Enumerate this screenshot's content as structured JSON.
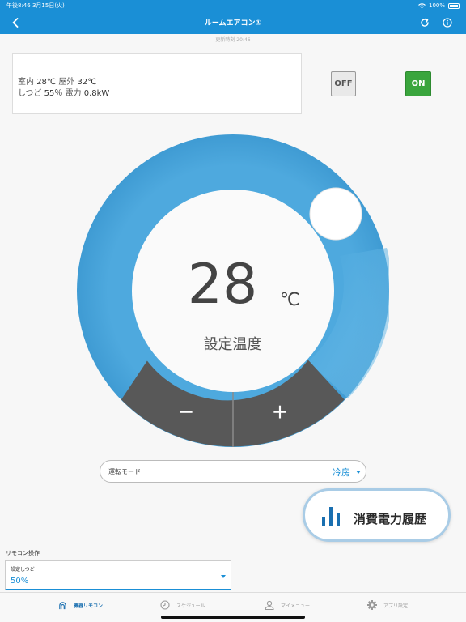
{
  "status_bar": {
    "time": "午後8:46",
    "date": "3月15日(火)",
    "battery": "100%"
  },
  "header": {
    "title": "ルームエアコン①"
  },
  "update_time": "---- 更新時刻 20:46 ----",
  "sensor_info": {
    "indoor_label": "室内",
    "indoor_value": "28℃",
    "outdoor_label": "屋外",
    "outdoor_value": "32℃",
    "humidity_label": "しつど",
    "humidity_value": "55％",
    "power_label": "電力",
    "power_value": "0.8kW"
  },
  "power_buttons": {
    "off_label": "OFF",
    "on_label": "ON"
  },
  "thermostat": {
    "set_temperature": "28",
    "unit": "℃",
    "label": "設定温度",
    "minus_label": "－",
    "plus_label": "＋"
  },
  "mode_select": {
    "label": "運転モード",
    "value": "冷房"
  },
  "power_history": {
    "label": "消費電力履歴"
  },
  "remote_section": {
    "header": "リモコン操作",
    "humidity_field": {
      "label": "設定しつど",
      "value": "50%"
    }
  },
  "tab_bar": {
    "items": [
      {
        "label": "機器リモコン",
        "icon": "router-icon",
        "active": true
      },
      {
        "label": "スケジュール",
        "icon": "clock-icon",
        "active": false
      },
      {
        "label": "マイメニュー",
        "icon": "person-icon",
        "active": false
      },
      {
        "label": "アプリ設定",
        "icon": "gear-icon",
        "active": false
      }
    ]
  },
  "colors": {
    "accent": "#1a8fd6",
    "dial": "#45a4dc",
    "on_button": "#3aa53d",
    "button_dark": "#585858"
  }
}
